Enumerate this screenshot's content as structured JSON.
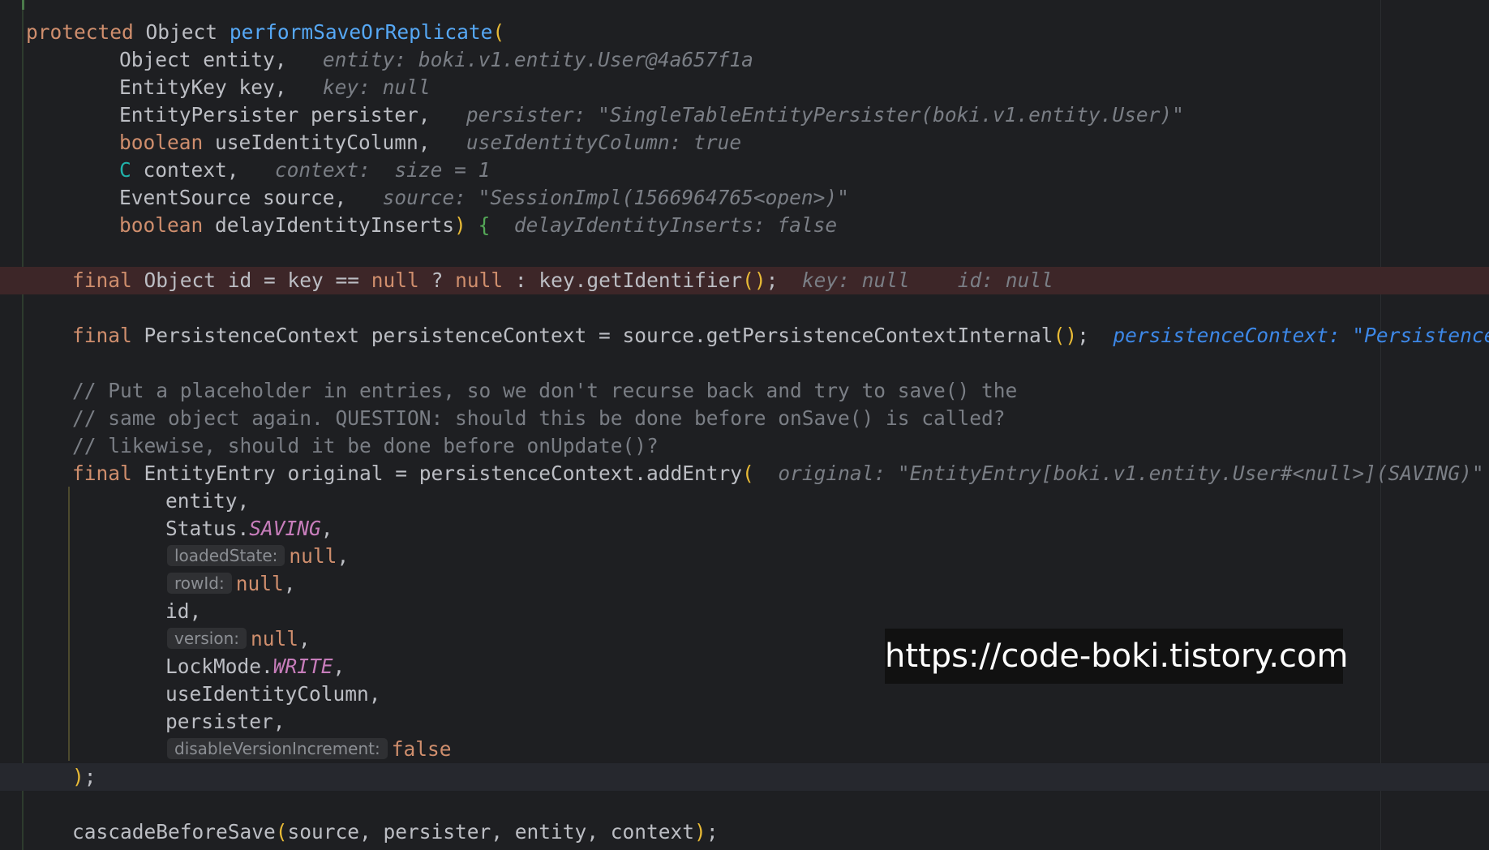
{
  "editor": {
    "signature": {
      "modifier": "protected",
      "return_type": "Object",
      "method_name": "performSaveOrReplicate",
      "open_paren": "("
    },
    "params": [
      {
        "type": "Object",
        "name": "entity,",
        "hint": "entity: boki.v1.entity.User@4a657f1a"
      },
      {
        "type": "EntityKey",
        "name": "key,",
        "hint": "key: null"
      },
      {
        "type": "EntityPersister",
        "name": "persister,",
        "hint": "persister: \"SingleTableEntityPersister(boki.v1.entity.User)\""
      },
      {
        "type": "boolean",
        "name": "useIdentityColumn,",
        "hint": "useIdentityColumn: true"
      },
      {
        "type": "C",
        "name": "context,",
        "hint": "context:  size = 1"
      },
      {
        "type": "EventSource",
        "name": "source,",
        "hint": "source: \"SessionImpl(1566964765<open>)\""
      },
      {
        "type": "boolean",
        "name": "delayIdentityInserts",
        "hint": "delayIdentityInserts: false"
      }
    ],
    "line_id": {
      "kw_final": "final",
      "text1": "Object id = key == ",
      "null1": "null",
      "text2": " ? ",
      "null2": "null",
      "text3": " : key.getIdentifier",
      "text4": ";",
      "hint1": "key: null",
      "hint2": "id: null"
    },
    "line_pc": {
      "kw_final": "final",
      "text1": "PersistenceContext persistenceContext = source.getPersistenceContextInternal",
      "text2": ";",
      "hint": "persistenceContext: \"PersistenceCo"
    },
    "comments": [
      "// Put a placeholder in entries, so we don't recurse back and try to save() the",
      "// same object again. QUESTION: should this be done before onSave() is called?",
      "// likewise, should it be done before onUpdate()?"
    ],
    "line_entry": {
      "kw_final": "final",
      "text": "EntityEntry original = persistenceContext.addEntry",
      "hint": "original: \"EntityEntry[boki.v1.entity.User#<null>](SAVING)\""
    },
    "args": {
      "entity": "entity,",
      "status_prefix": "Status.",
      "status_const": "SAVING",
      "comma": ",",
      "loaded_state_label": "loadedState:",
      "rowid_label": "rowId:",
      "null_value": "null",
      "id": "id,",
      "version_label": "version:",
      "lockmode_prefix": "LockMode.",
      "lockmode_const": "WRITE",
      "use_identity": "useIdentityColumn,",
      "persister": "persister,",
      "disable_label": "disableVersionIncrement:",
      "false_value": "false"
    },
    "close_line": {
      "paren": ")",
      "semi": ";"
    },
    "cascade_line": {
      "name": "cascadeBeforeSave",
      "args": "source, persister, entity, context",
      "semi": ";"
    }
  },
  "watermark": "https://code-boki.tistory.com"
}
